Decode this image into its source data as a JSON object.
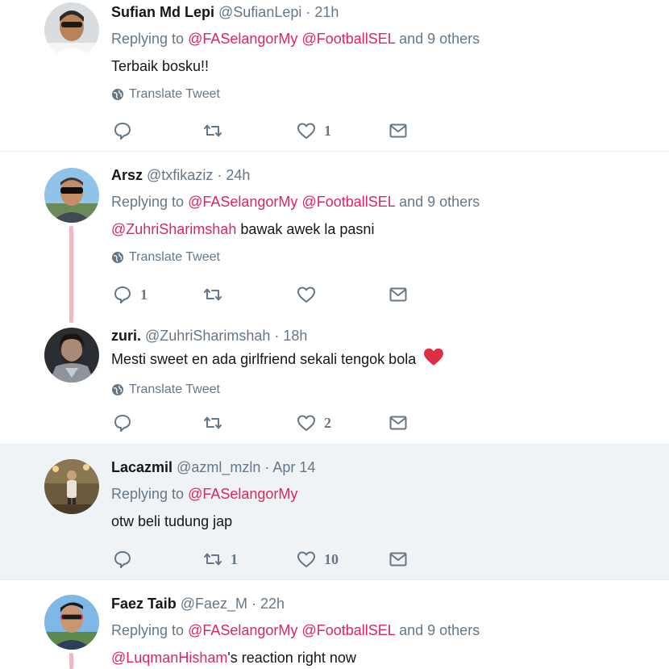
{
  "tweets": [
    {
      "name": "Sufian Md Lepi",
      "handle": "@SufianLepi",
      "dot": "·",
      "time": "21h",
      "replying_prefix": "Replying to",
      "replying_mentions": [
        "@FASelangorMy",
        "@FootballSEL"
      ],
      "replying_suffix": "and 9 others",
      "text": "Terbaik bosku!!",
      "translate": "Translate Tweet",
      "reply_count": "",
      "retweet_count": "",
      "like_count": "1"
    },
    {
      "name": "Arsz",
      "handle": "@txfikaziz",
      "dot": "·",
      "time": "24h",
      "replying_prefix": "Replying to",
      "replying_mentions": [
        "@FASelangorMy",
        "@FootballSEL"
      ],
      "replying_suffix": "and 9 others",
      "text_mention": "@ZuhriSharimshah",
      "text": " bawak awek la pasni",
      "translate": "Translate Tweet",
      "reply_count": "1",
      "retweet_count": "",
      "like_count": ""
    },
    {
      "name": "zuri.",
      "handle": "@ZuhriSharimshah",
      "dot": "·",
      "time": "18h",
      "text": "Mesti sweet en ada girlfriend sekali tengok bola",
      "text_emoji": "red-heart",
      "translate": "Translate Tweet",
      "reply_count": "",
      "retweet_count": "",
      "like_count": "2"
    },
    {
      "name": "Lacazmil",
      "handle": "@azml_mzln",
      "dot": "·",
      "time": "Apr 14",
      "replying_prefix": "Replying to",
      "replying_mentions": [
        "@FASelangorMy"
      ],
      "text": "otw beli tudung jap",
      "reply_count": "",
      "retweet_count": "1",
      "like_count": "10"
    },
    {
      "name": "Faez Taib",
      "handle": "@Faez_M",
      "dot": "·",
      "time": "22h",
      "replying_prefix": "Replying to",
      "replying_mentions": [
        "@FASelangorMy",
        "@FootballSEL"
      ],
      "replying_suffix": "and 9 others",
      "text_mention": "@LuqmanHisham",
      "text": "'s reaction right now"
    }
  ],
  "colors": {
    "mention": "#e0245e",
    "secondary": "#657786",
    "highlight_bg": "#f0f3f6",
    "thread_line": "#f0b8c2"
  },
  "icons": [
    "reply-icon",
    "retweet-icon",
    "like-icon",
    "direct-message-icon",
    "globe-icon",
    "red-heart-emoji"
  ]
}
